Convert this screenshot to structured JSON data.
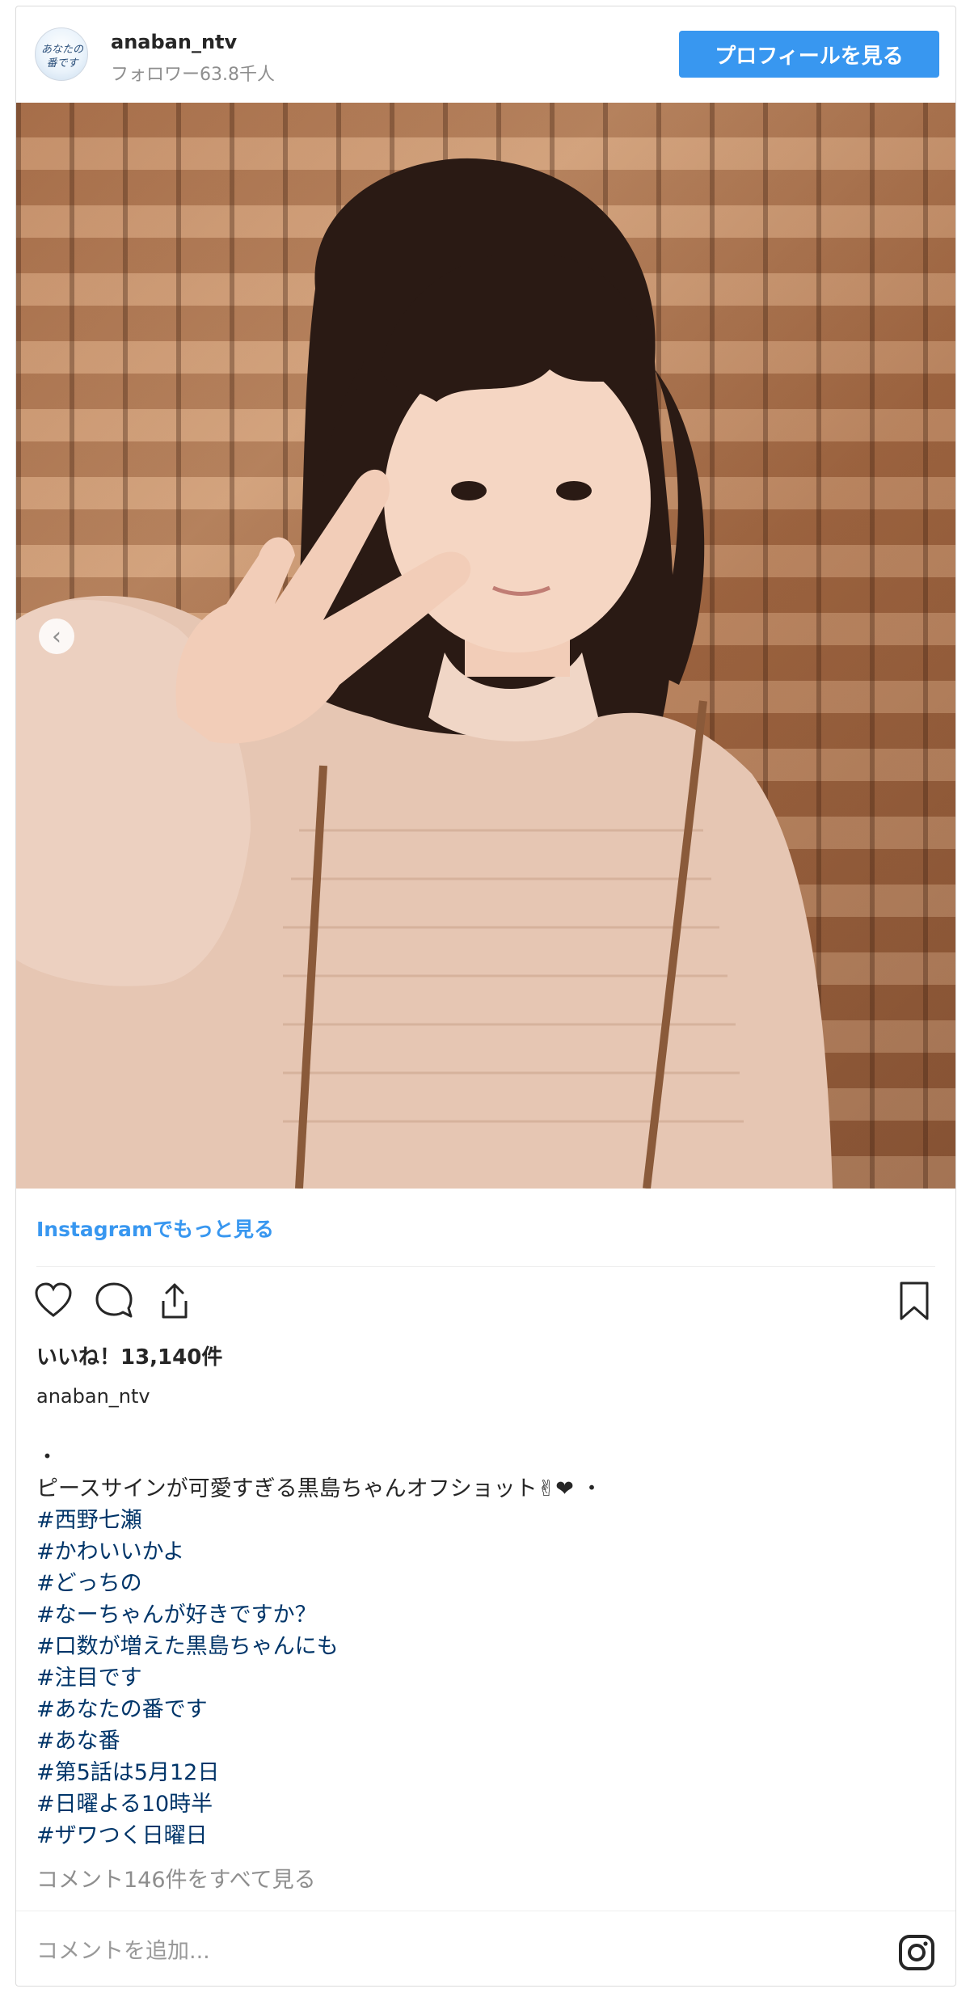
{
  "header": {
    "avatar_icon": "anaban-logo-avatar",
    "avatar_text": "あなたの番です",
    "username": "anaban_ntv",
    "followers": "フォロワー63.8千人",
    "profile_button": "プロフィールを見る"
  },
  "photo": {
    "icon_prev": "chevron-left-icon",
    "prev_glyph": "‹"
  },
  "view_more": "Instagramでもっと見る",
  "actions": {
    "icons": [
      "heart-icon",
      "comment-icon",
      "share-icon",
      "bookmark-icon"
    ]
  },
  "likes": "いいね！13,140件",
  "caption": {
    "username": "anaban_ntv",
    "lines": [
      "・",
      "ピースサインが可愛すぎる黒島ちゃんオフショット✌❤ ・",
      "#西野七瀬",
      "#かわいいかよ",
      "#どっちの",
      "#なーちゃんが好きですか？",
      "#口数が増えた黒島ちゃんにも",
      "#注目です",
      "#あなたの番です",
      "#あな番",
      "#第5話は5月12日",
      "#日曜よる10時半",
      "#ザワつく日曜日"
    ]
  },
  "view_comments": "コメント146件をすべて見る",
  "comment": {
    "placeholder": "コメントを追加...",
    "icon": "instagram-icon"
  },
  "colors": {
    "accent": "#3897f0",
    "hashtag": "#003569",
    "muted": "#8e8e8e"
  }
}
